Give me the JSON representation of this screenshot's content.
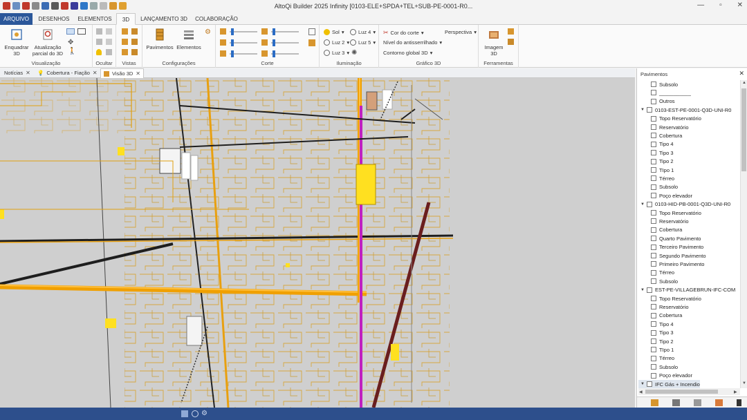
{
  "window": {
    "title": "AltoQi Builder 2025 Infinity [0103-ELE+SPDA+TEL+SUB-PE-0001-R0...",
    "controls": [
      "—",
      "▫",
      "✕"
    ]
  },
  "menu": {
    "tabs": [
      "ARQUIVO",
      "DESENHOS",
      "ELEMENTOS",
      "3D",
      "LANÇAMENTO 3D",
      "COLABORAÇÃO"
    ],
    "active": "3D"
  },
  "ribbon": {
    "visualizacao": {
      "label": "Visualização",
      "enquadrar": "Enquadrar\n3D",
      "atualizacao": "Atualização\nparcial do 3D"
    },
    "ocultar": {
      "label": "Ocultar"
    },
    "vistas": {
      "label": "Vistas"
    },
    "configuracoes": {
      "label": "Configurações",
      "pavimentos": "Pavimentos",
      "elementos": "Elementos"
    },
    "corte": {
      "label": "Corte"
    },
    "iluminacao": {
      "label": "Iluminação",
      "sol": "Sol",
      "luz2": "Luz 2",
      "luz3": "Luz 3",
      "luz4": "Luz 4",
      "luz5": "Luz 5"
    },
    "grafico3d": {
      "label": "Gráfico 3D",
      "cor_corte": "Cor do corte",
      "antisserrilhado": "Nível do antisserrilhado",
      "contorno": "Contorno global 3D",
      "perspectiva": "Perspectiva"
    },
    "ferramentas": {
      "label": "Ferramentas",
      "imagem3d": "Imagem\n3D"
    }
  },
  "doc_tabs": [
    {
      "label": "Notícias",
      "active": false
    },
    {
      "label": "Cobertura - Fiação",
      "active": false
    },
    {
      "label": "Visão 3D",
      "active": true
    }
  ],
  "panel": {
    "title": "Pavimentos",
    "tree": [
      {
        "label": "Subsolo",
        "level": 1
      },
      {
        "label": "___________",
        "level": 1
      },
      {
        "label": "Outros",
        "level": 1
      },
      {
        "label": "0103-EST-PE-0001-Q3D-UNI-R0",
        "level": 0
      },
      {
        "label": "Topo Reservatório",
        "level": 1
      },
      {
        "label": "Reservatório",
        "level": 1
      },
      {
        "label": "Cobertura",
        "level": 1
      },
      {
        "label": "Tipo 4",
        "level": 1
      },
      {
        "label": "Tipo 3",
        "level": 1
      },
      {
        "label": "Tipo 2",
        "level": 1
      },
      {
        "label": "TIpo 1",
        "level": 1
      },
      {
        "label": "Térreo",
        "level": 1
      },
      {
        "label": "Subsolo",
        "level": 1
      },
      {
        "label": "Poço elevador",
        "level": 1
      },
      {
        "label": "0103-HID-PB-0001-Q3D-UNI-R0",
        "level": 0
      },
      {
        "label": "Topo Reservatório",
        "level": 1
      },
      {
        "label": "Reservatório",
        "level": 1
      },
      {
        "label": "Cobertura",
        "level": 1
      },
      {
        "label": "Quarto Pavimento",
        "level": 1
      },
      {
        "label": "Terceiro Pavimento",
        "level": 1
      },
      {
        "label": "Segundo Pavimento",
        "level": 1
      },
      {
        "label": "Primeiro Pavimento",
        "level": 1
      },
      {
        "label": "Térreo",
        "level": 1
      },
      {
        "label": "Subsolo",
        "level": 1
      },
      {
        "label": "EST-PE-VILLAGEBRUN-IFC-COM",
        "level": 0
      },
      {
        "label": "Topo Reservatório",
        "level": 1
      },
      {
        "label": "Reservatório",
        "level": 1
      },
      {
        "label": "Cobertura",
        "level": 1
      },
      {
        "label": "Tipo 4",
        "level": 1
      },
      {
        "label": "Tipo 3",
        "level": 1
      },
      {
        "label": "Tipo 2",
        "level": 1
      },
      {
        "label": "TIpo 1",
        "level": 1
      },
      {
        "label": "Térreo",
        "level": 1
      },
      {
        "label": "Subsolo",
        "level": 1
      },
      {
        "label": "Poço elevador",
        "level": 1
      },
      {
        "label": "IFC Gás + Incendio",
        "level": 0
      }
    ]
  },
  "colors": {
    "accent": "#2b579a",
    "statusbar": "#2d4f8c",
    "pipe_orange": "#f0a000",
    "pipe_black": "#1e1e1e",
    "pipe_magenta": "#c020c0",
    "viewport_bg": "#cfcfcf"
  }
}
